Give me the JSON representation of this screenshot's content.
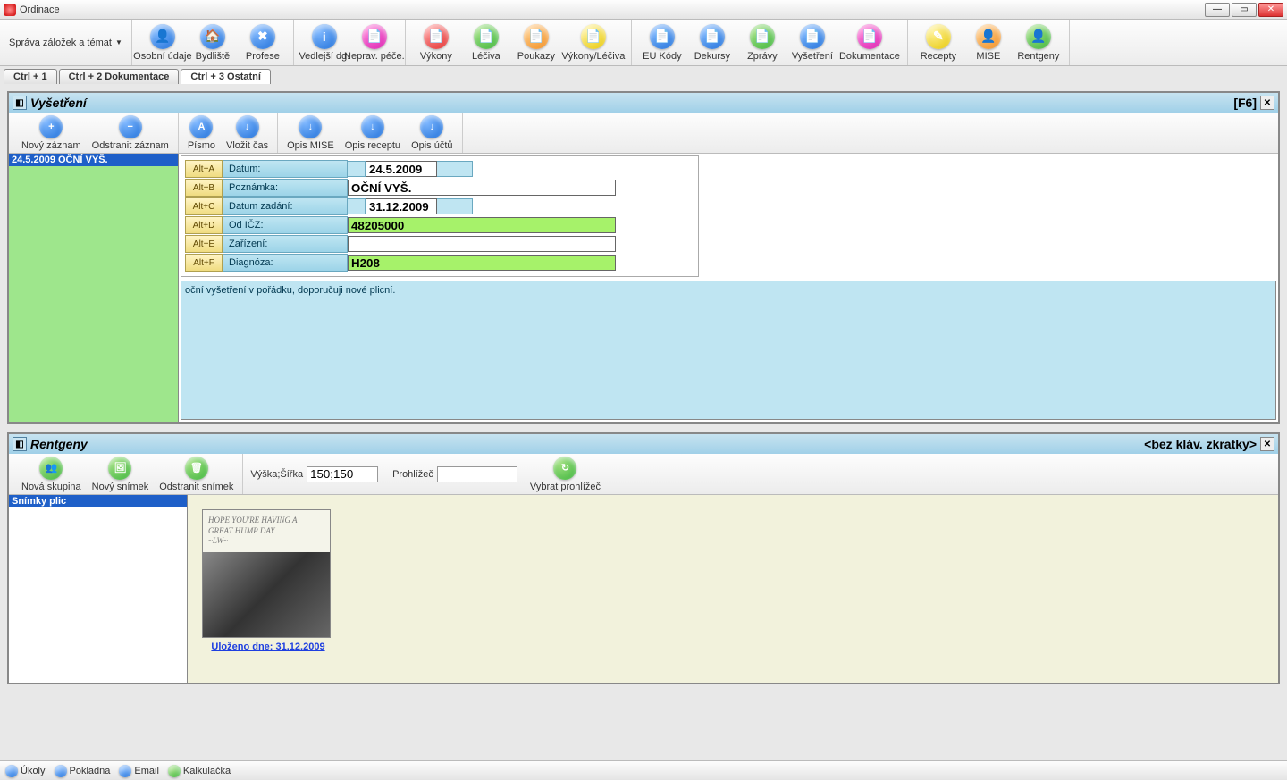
{
  "window": {
    "title": "Ordinace"
  },
  "menu": {
    "label": "Správa záložek a témat"
  },
  "toolbar": [
    [
      {
        "label": "Osobní údaje",
        "color": "c-blue",
        "glyph": "👤"
      },
      {
        "label": "Bydliště",
        "color": "c-blue",
        "glyph": "🏠"
      },
      {
        "label": "Profese",
        "color": "c-blue",
        "glyph": "✖"
      }
    ],
    [
      {
        "label": "Vedlejší dg.",
        "color": "c-blue",
        "glyph": "i"
      },
      {
        "label": "Neprav. péče.",
        "color": "c-mag",
        "glyph": "📄"
      }
    ],
    [
      {
        "label": "Výkony",
        "color": "c-red",
        "glyph": "📄"
      },
      {
        "label": "Léčiva",
        "color": "c-grn",
        "glyph": "📄"
      },
      {
        "label": "Poukazy",
        "color": "c-org",
        "glyph": "📄"
      },
      {
        "label": "Výkony/Léčiva",
        "color": "c-yel",
        "glyph": "📄",
        "wide": true
      }
    ],
    [
      {
        "label": "EU Kódy",
        "color": "c-blue",
        "glyph": "📄"
      },
      {
        "label": "Dekursy",
        "color": "c-blue",
        "glyph": "📄"
      },
      {
        "label": "Zprávy",
        "color": "c-grn",
        "glyph": "📄"
      },
      {
        "label": "Vyšetření",
        "color": "c-blue",
        "glyph": "📄"
      },
      {
        "label": "Dokumentace",
        "color": "c-mag",
        "glyph": "📄",
        "wide": true
      }
    ],
    [
      {
        "label": "Recepty",
        "color": "c-yel",
        "glyph": "✎"
      },
      {
        "label": "MISE",
        "color": "c-org",
        "glyph": "👤"
      },
      {
        "label": "Rentgeny",
        "color": "c-grn",
        "glyph": "👤"
      }
    ]
  ],
  "tabs": [
    {
      "label": "Ctrl + 1",
      "active": false
    },
    {
      "label": "Ctrl + 2 Dokumentace",
      "active": false
    },
    {
      "label": "Ctrl + 3 Ostatní",
      "active": true
    }
  ],
  "vysetreni": {
    "title": "Vyšetření",
    "shortcut": "[F6]",
    "toolbar": [
      [
        {
          "label": "Nový záznam",
          "glyph": "+",
          "color": "c-blue"
        },
        {
          "label": "Odstranit záznam",
          "glyph": "−",
          "color": "c-blue"
        }
      ],
      [
        {
          "label": "Písmo",
          "glyph": "A",
          "color": "c-blue"
        },
        {
          "label": "Vložit čas",
          "glyph": "↓",
          "color": "c-blue"
        }
      ],
      [
        {
          "label": "Opis MISE",
          "glyph": "↓",
          "color": "c-blue"
        },
        {
          "label": "Opis receptu",
          "glyph": "↓",
          "color": "c-blue"
        },
        {
          "label": "Opis účtů",
          "glyph": "↓",
          "color": "c-blue"
        }
      ]
    ],
    "list_selected": "24.5.2009 OČNÍ VYŠ.",
    "form": [
      {
        "hot": "Alt+A",
        "label": "Datum:",
        "value": "24.5.2009",
        "style": "date"
      },
      {
        "hot": "Alt+B",
        "label": "Poznámka:",
        "value": "OČNÍ VYŠ.",
        "style": "white-full"
      },
      {
        "hot": "Alt+C",
        "label": "Datum zadání:",
        "value": "31.12.2009",
        "style": "date"
      },
      {
        "hot": "Alt+D",
        "label": "Od IČZ:",
        "value": "48205000",
        "style": "green-full"
      },
      {
        "hot": "Alt+E",
        "label": "Zařízení:",
        "value": "",
        "style": "white-full"
      },
      {
        "hot": "Alt+F",
        "label": "Diagnóza:",
        "value": "H208",
        "style": "green-full"
      }
    ],
    "note_text": "oční vyšetření v pořádku, doporučuji nové plicní."
  },
  "rentgeny": {
    "title": "Rentgeny",
    "shortcut": "<bez kláv. zkratky>",
    "toolbar": [
      {
        "label": "Nová skupina",
        "glyph": "👥",
        "color": "c-grn"
      },
      {
        "label": "Nový snímek",
        "glyph": "🖼",
        "color": "c-grn"
      },
      {
        "label": "Odstranit snímek",
        "glyph": "🗑",
        "color": "c-grn"
      }
    ],
    "size_label": "Výška;Šířka",
    "size_value": "150;150",
    "viewer_label": "Prohlížeč",
    "viewer_value": "",
    "viewer_button": {
      "label": "Vybrat prohlížeč",
      "glyph": "↻",
      "color": "c-grn"
    },
    "list_selected": "Snímky plic",
    "thumb_overlay_l1": "HOPE YOU'RE HAVING A",
    "thumb_overlay_l2": "GREAT HUMP DAY",
    "thumb_overlay_l3": "~LW~",
    "thumb_caption": "Uloženo dne: 31.12.2009"
  },
  "statusbar": [
    {
      "label": "Úkoly",
      "color": "c-blue"
    },
    {
      "label": "Pokladna",
      "color": "c-blue"
    },
    {
      "label": "Email",
      "color": "c-blue"
    },
    {
      "label": "Kalkulačka",
      "color": "c-grn"
    }
  ]
}
